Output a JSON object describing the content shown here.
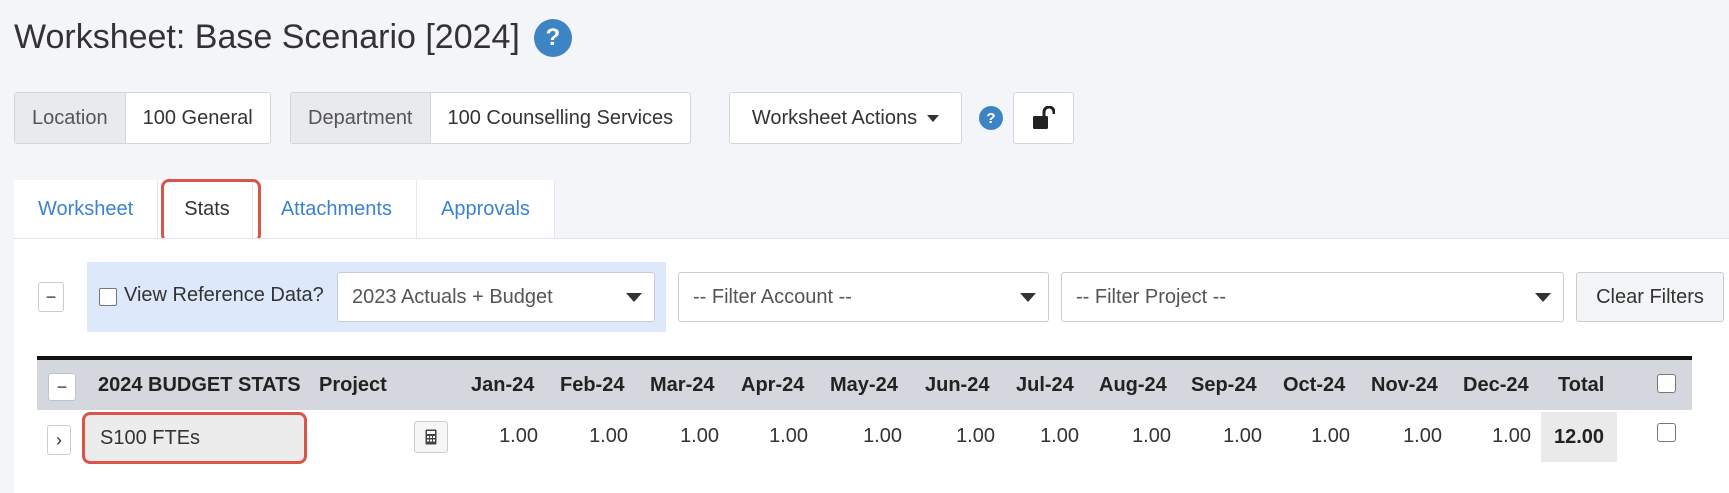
{
  "header": {
    "title": "Worksheet: Base Scenario [2024]",
    "help_glyph": "?"
  },
  "filters_top": {
    "location_label": "Location",
    "location_value": "100 General",
    "department_label": "Department",
    "department_value": "100 Counselling Services",
    "actions_label": "Worksheet Actions",
    "help_glyph": "?"
  },
  "tabs": [
    {
      "label": "Worksheet",
      "active": false
    },
    {
      "label": "Stats",
      "active": true
    },
    {
      "label": "Attachments",
      "active": false
    },
    {
      "label": "Approvals",
      "active": false
    }
  ],
  "toolbar": {
    "collapse_glyph": "−",
    "reference_checkbox_label": "View Reference Data?",
    "reference_checked": false,
    "reference_select": "2023 Actuals + Budget",
    "account_filter_placeholder": "-- Filter Account --",
    "project_filter_placeholder": "-- Filter Project --",
    "clear_filters_label": "Clear Filters"
  },
  "table": {
    "collapse_glyph": "−",
    "headers": {
      "name": "2024 BUDGET STATS",
      "project": "Project",
      "months": [
        "Jan-24",
        "Feb-24",
        "Mar-24",
        "Apr-24",
        "May-24",
        "Jun-24",
        "Jul-24",
        "Aug-24",
        "Sep-24",
        "Oct-24",
        "Nov-24",
        "Dec-24"
      ],
      "total": "Total"
    },
    "rows": [
      {
        "expand_glyph": "›",
        "name": "S100 FTEs",
        "values": [
          "1.00",
          "1.00",
          "1.00",
          "1.00",
          "1.00",
          "1.00",
          "1.00",
          "1.00",
          "1.00",
          "1.00",
          "1.00",
          "1.00"
        ],
        "total": "12.00",
        "selected": false
      }
    ]
  },
  "colors": {
    "accent_blue": "#3d84c4",
    "link_blue": "#3b82d6",
    "highlight_red": "#d9554a",
    "header_gray": "#d4d8de"
  },
  "icons": [
    "help-icon",
    "caret-down-icon",
    "unlock-icon",
    "calculator-icon",
    "chevron-right-icon",
    "minus-icon"
  ]
}
